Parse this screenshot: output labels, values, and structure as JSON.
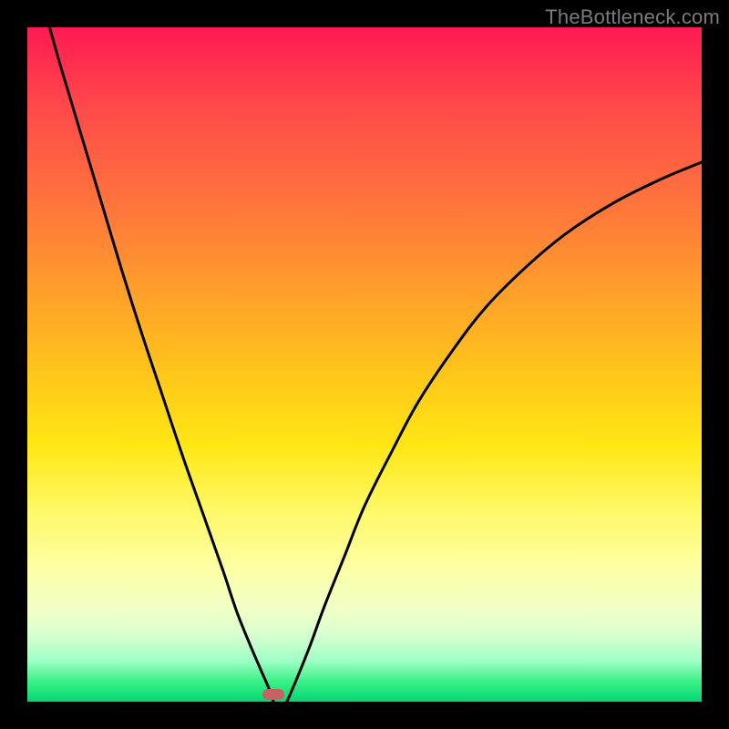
{
  "watermark": "TheBottleneck.com",
  "marker": {
    "x_fraction": 0.365,
    "y_fraction": 0.989
  },
  "colors": {
    "curve_stroke": "#000000",
    "marker_fill": "#c76262",
    "frame_bg": "#000000"
  },
  "chart_data": {
    "type": "line",
    "title": "",
    "xlabel": "",
    "ylabel": "",
    "xlim": [
      0,
      1
    ],
    "ylim": [
      0,
      1
    ],
    "series": [
      {
        "name": "left-branch",
        "x": [
          0.033,
          0.05,
          0.08,
          0.11,
          0.14,
          0.17,
          0.2,
          0.23,
          0.26,
          0.29,
          0.31,
          0.33,
          0.345,
          0.358,
          0.365
        ],
        "y": [
          1.0,
          0.94,
          0.84,
          0.74,
          0.64,
          0.545,
          0.455,
          0.365,
          0.28,
          0.195,
          0.135,
          0.085,
          0.05,
          0.02,
          0.0
        ]
      },
      {
        "name": "right-branch",
        "x": [
          0.385,
          0.4,
          0.42,
          0.44,
          0.47,
          0.5,
          0.54,
          0.58,
          0.63,
          0.68,
          0.74,
          0.8,
          0.87,
          0.94,
          1.0
        ],
        "y": [
          0.0,
          0.035,
          0.085,
          0.14,
          0.215,
          0.29,
          0.37,
          0.445,
          0.52,
          0.585,
          0.645,
          0.695,
          0.74,
          0.775,
          0.8
        ]
      }
    ],
    "gradient_stops": [
      {
        "pos": 0.0,
        "color": "#ff1a52"
      },
      {
        "pos": 0.5,
        "color": "#ffe714"
      },
      {
        "pos": 0.9,
        "color": "#d9ffd0"
      },
      {
        "pos": 1.0,
        "color": "#0ed173"
      }
    ],
    "marker": {
      "x": 0.365,
      "y": 0.011,
      "shape": "rounded-rect",
      "color": "#c76262"
    }
  }
}
